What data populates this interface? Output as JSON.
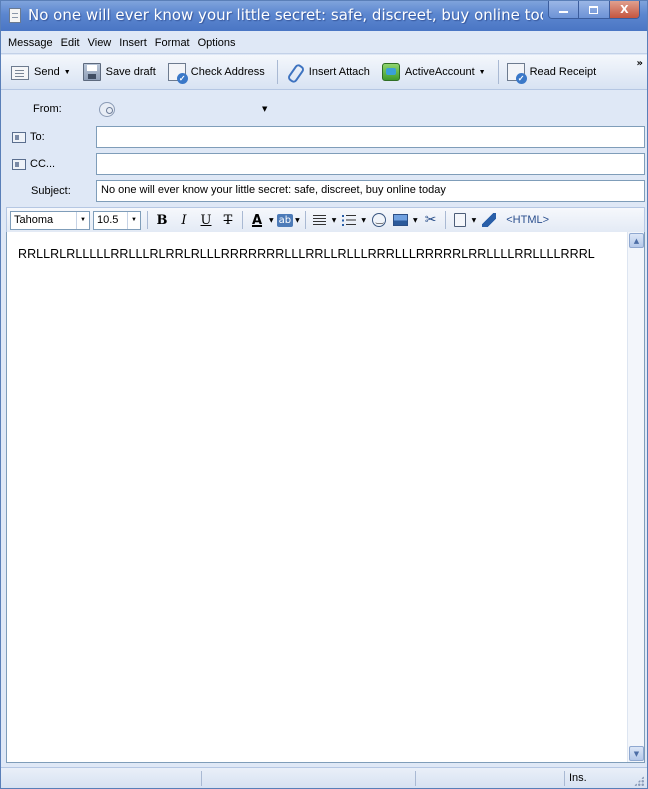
{
  "window": {
    "title": "No one will ever know your little secret: safe, discreet, buy online today -...",
    "min_glyph": "",
    "max_glyph": "",
    "close_glyph": "X"
  },
  "menu": [
    "Message",
    "Edit",
    "View",
    "Insert",
    "Format",
    "Options"
  ],
  "toolbar": {
    "send_label": "Send",
    "save_draft_label": "Save draft",
    "check_address_label": "Check Address",
    "insert_attach_label": "Insert Attach",
    "active_account_label": "ActiveAccount",
    "read_receipt_label": "Read Receipt",
    "overflow_glyph": "»",
    "dropdown_glyph": "▼"
  },
  "header": {
    "from_label": "From:",
    "from_value": "                          ",
    "to_label": "To:",
    "to_value": "              ",
    "cc_label": "CC...",
    "cc_value": "",
    "subject_label": "Subject:",
    "subject_value": "No one will ever know your little secret: safe, discreet, buy online today"
  },
  "format": {
    "font_name": "Tahoma",
    "font_size": "10.5",
    "bold_glyph": "B",
    "italic_glyph": "I",
    "underline_glyph": "U",
    "strike_glyph": "T",
    "font_color_glyph": "A",
    "highlight_glyph": "ab",
    "scissor_glyph": "✂",
    "html_label": "<HTML>"
  },
  "body": {
    "text": "RRLLRLRLLLLLRRLLLRLRRLRLLLRRRRRRRLLLRRLLRLLLRRRLLLRRRRRLRRLLLLRRLLLLRRRL"
  },
  "scrollbar": {
    "up_glyph": "▲",
    "down_glyph": "▼"
  },
  "status": {
    "mode": "Ins."
  }
}
